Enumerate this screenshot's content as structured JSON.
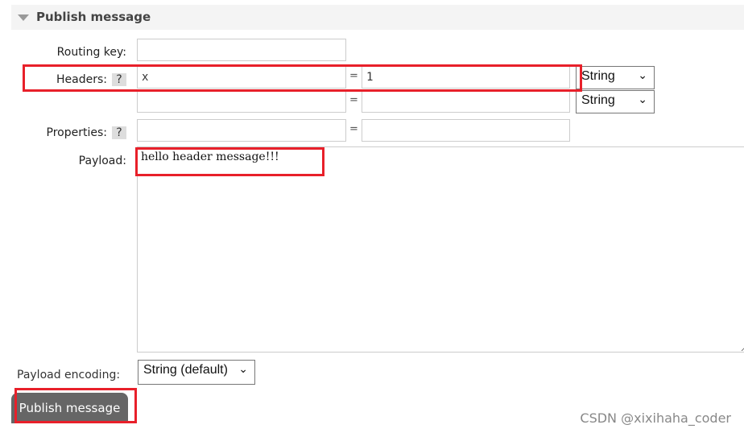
{
  "section": {
    "title": "Publish message"
  },
  "labels": {
    "routing_key": "Routing key:",
    "headers": "Headers:",
    "properties": "Properties:",
    "payload": "Payload:",
    "payload_encoding": "Payload encoding:",
    "help": "?",
    "equals": "="
  },
  "fields": {
    "routing_key": "",
    "headers": [
      {
        "key": "x",
        "value": "1",
        "type": "String"
      },
      {
        "key": "",
        "value": "",
        "type": "String"
      }
    ],
    "properties": [
      {
        "key": "",
        "value": ""
      }
    ],
    "payload": "hello header message!!!",
    "payload_encoding": "String (default)"
  },
  "buttons": {
    "publish": "Publish message"
  },
  "watermark": "CSDN @xixihaha_coder",
  "colors": {
    "annotation": "#e8202a",
    "button": "#666666"
  }
}
